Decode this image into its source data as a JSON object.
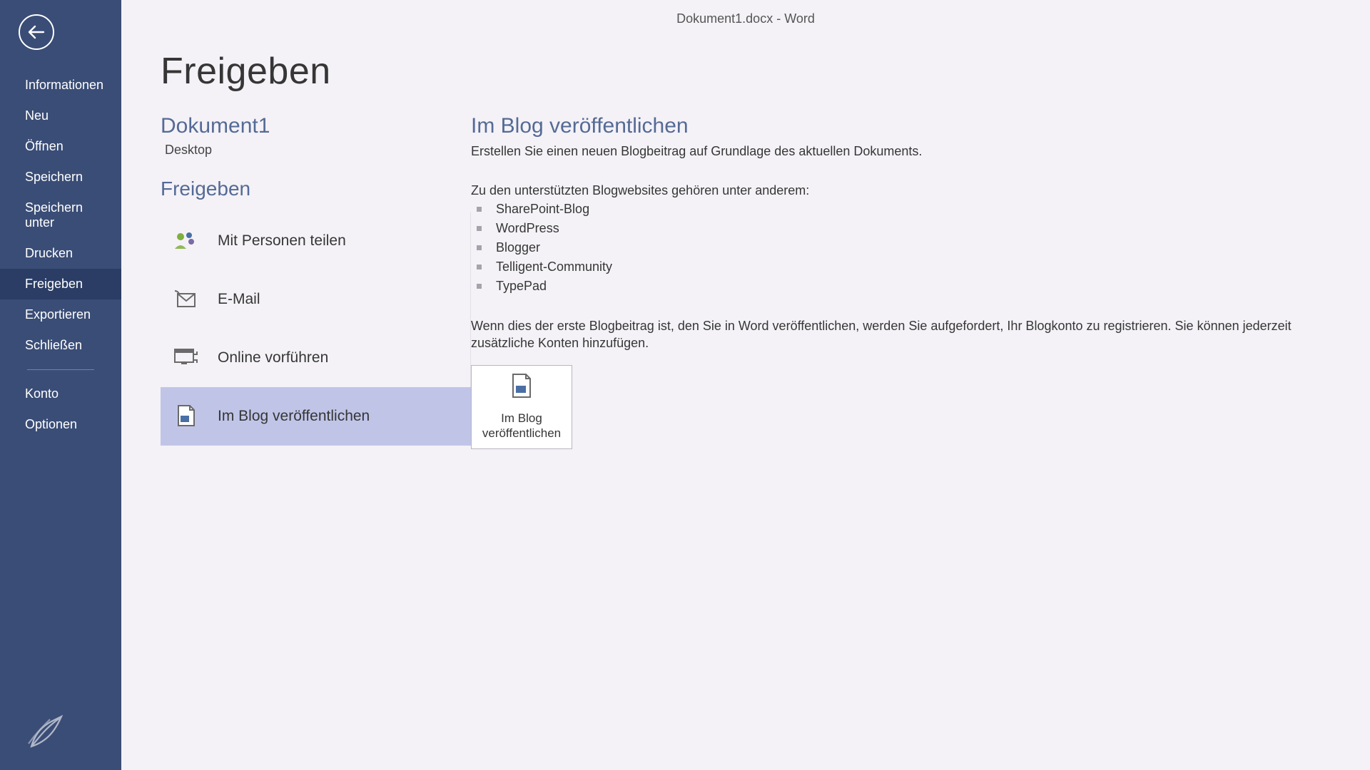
{
  "window": {
    "title": "Dokument1.docx - Word"
  },
  "sidebar": {
    "items": [
      {
        "label": "Informationen",
        "active": false
      },
      {
        "label": "Neu",
        "active": false
      },
      {
        "label": "Öffnen",
        "active": false
      },
      {
        "label": "Speichern",
        "active": false
      },
      {
        "label": "Speichern unter",
        "active": false
      },
      {
        "label": "Drucken",
        "active": false
      },
      {
        "label": "Freigeben",
        "active": true
      },
      {
        "label": "Exportieren",
        "active": false
      },
      {
        "label": "Schließen",
        "active": false
      }
    ],
    "footer_items": [
      {
        "label": "Konto"
      },
      {
        "label": "Optionen"
      }
    ]
  },
  "page": {
    "title": "Freigeben"
  },
  "document": {
    "title": "Dokument1",
    "location": "Desktop"
  },
  "share": {
    "section_label": "Freigeben",
    "items": [
      {
        "label": "Mit Personen teilen",
        "icon": "people-icon",
        "selected": false
      },
      {
        "label": "E-Mail",
        "icon": "email-icon",
        "selected": false
      },
      {
        "label": "Online vorführen",
        "icon": "present-online-icon",
        "selected": false
      },
      {
        "label": "Im Blog veröffentlichen",
        "icon": "blog-icon",
        "selected": true
      }
    ]
  },
  "detail": {
    "title": "Im Blog veröffentlichen",
    "description": "Erstellen Sie einen neuen Blogbeitrag auf Grundlage des aktuellen Dokuments.",
    "supported_label": "Zu den unterstützten Blogwebsites gehören unter anderem:",
    "sites": [
      "SharePoint-Blog",
      "WordPress",
      "Blogger",
      "Telligent-Community",
      "TypePad"
    ],
    "note": "Wenn dies der erste Blogbeitrag ist, den Sie in Word veröffentlichen, werden Sie aufgefordert, Ihr Blogkonto zu registrieren. Sie können jederzeit zusätzliche Konten hinzufügen.",
    "button_label": "Im Blog\nveröffentlichen"
  }
}
